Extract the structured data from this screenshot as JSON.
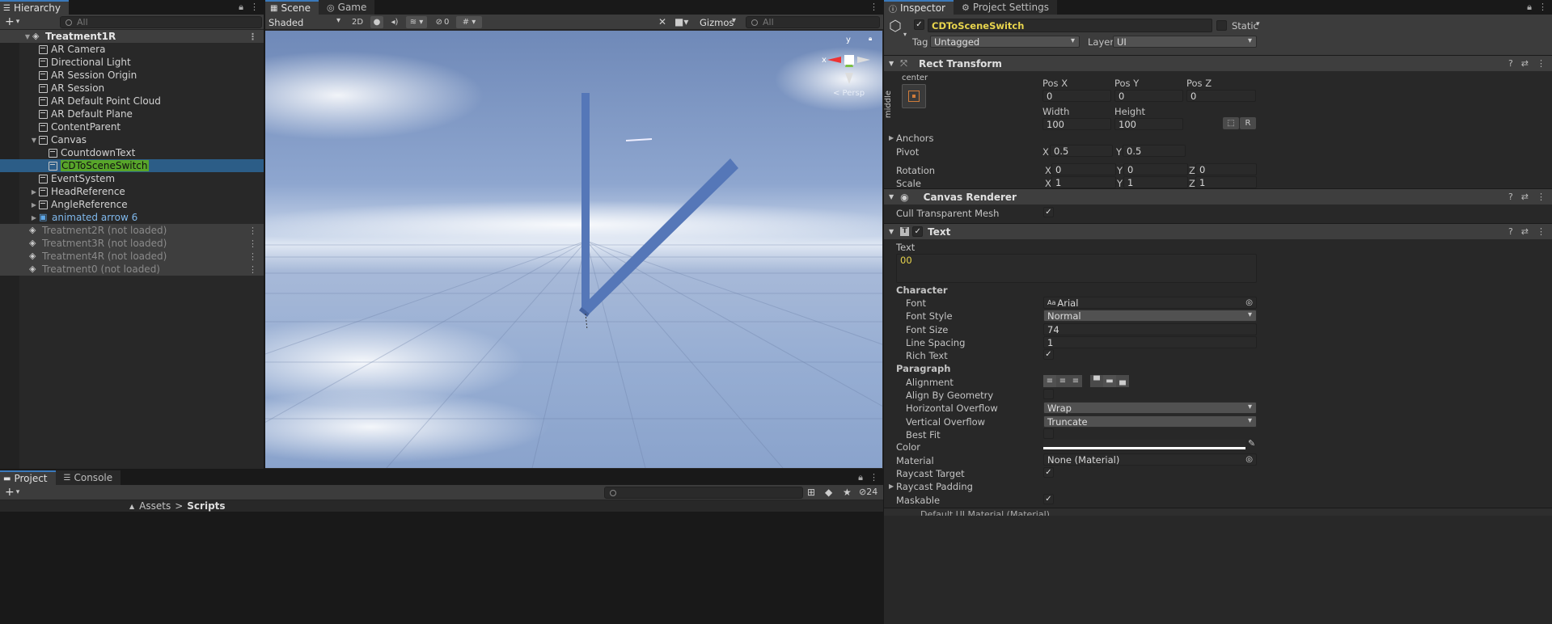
{
  "hierarchy": {
    "tab": "Hierarchy",
    "search_placeholder": "All",
    "scene": "Treatment1R",
    "items": [
      "AR Camera",
      "Directional Light",
      "AR Session Origin",
      "AR Session",
      "AR Default Point Cloud",
      "AR Default Plane",
      "ContentParent",
      "Canvas"
    ],
    "canvas_children": [
      "CountdownText",
      "CDToSceneSwitch"
    ],
    "items_after": [
      "EventSystem",
      "HeadReference",
      "AngleReference",
      "animated arrow 6"
    ],
    "unloaded": [
      "Treatment2R (not loaded)",
      "Treatment3R (not loaded)",
      "Treatment4R (not loaded)",
      "Treatment0 (not loaded)"
    ]
  },
  "scene": {
    "tab_scene": "Scene",
    "tab_game": "Game",
    "shading": "Shaded",
    "mode2d": "2D",
    "hidden_count": "0",
    "gizmos": "Gizmos",
    "search_placeholder": "All",
    "persp": "< Persp",
    "axis_x": "x",
    "axis_y": "y"
  },
  "bottom": {
    "tab_project": "Project",
    "tab_console": "Console",
    "breadcrumb_root": "Assets",
    "breadcrumb_sep": ">",
    "breadcrumb_current": "Scripts",
    "badge": "24",
    "partial_text": "Default UI Material (Material)"
  },
  "inspector": {
    "tab_inspector": "Inspector",
    "tab_settings": "Project Settings",
    "name": "CDToSceneSwitch",
    "static_label": "Static",
    "tag_label": "Tag",
    "tag_value": "Untagged",
    "layer_label": "Layer",
    "layer_value": "UI",
    "rect": {
      "title": "Rect Transform",
      "anchor_h": "center",
      "anchor_v": "middle",
      "posx_label": "Pos X",
      "posx": "0",
      "posy_label": "Pos Y",
      "posy": "0",
      "posz_label": "Pos Z",
      "posz": "0",
      "width_label": "Width",
      "width": "100",
      "height_label": "Height",
      "height": "100",
      "r_btn": "R",
      "anchors": "Anchors",
      "pivot": "Pivot",
      "pivot_x": "0.5",
      "pivot_y": "0.5",
      "rotation": "Rotation",
      "rot_x": "0",
      "rot_y": "0",
      "rot_z": "0",
      "scale": "Scale",
      "scale_x": "1",
      "scale_y": "1",
      "scale_z": "1",
      "x": "X",
      "y": "Y",
      "z": "Z"
    },
    "canvas_renderer": {
      "title": "Canvas Renderer",
      "cull_label": "Cull Transparent Mesh"
    },
    "text": {
      "title": "Text",
      "text_label": "Text",
      "text_value": "00",
      "character": "Character",
      "font_label": "Font",
      "font_value": "Arial",
      "font_prefix": "Aa",
      "style_label": "Font Style",
      "style_value": "Normal",
      "size_label": "Font Size",
      "size_value": "74",
      "spacing_label": "Line Spacing",
      "spacing_value": "1",
      "rich_label": "Rich Text",
      "paragraph": "Paragraph",
      "alignment_label": "Alignment",
      "geometry_label": "Align By Geometry",
      "hover_label": "Horizontal Overflow",
      "hover_value": "Wrap",
      "vover_label": "Vertical Overflow",
      "vover_value": "Truncate",
      "bestfit_label": "Best Fit",
      "color_label": "Color",
      "material_label": "Material",
      "material_value": "None (Material)",
      "raycast_label": "Raycast Target",
      "padding_label": "Raycast Padding",
      "maskable_label": "Maskable"
    }
  },
  "colors": {
    "accent": "#3a79bb",
    "selection": "#2c5d87",
    "highlight": "#58a52a",
    "bar": "#5577b8",
    "name_yellow": "#e8d44d"
  }
}
